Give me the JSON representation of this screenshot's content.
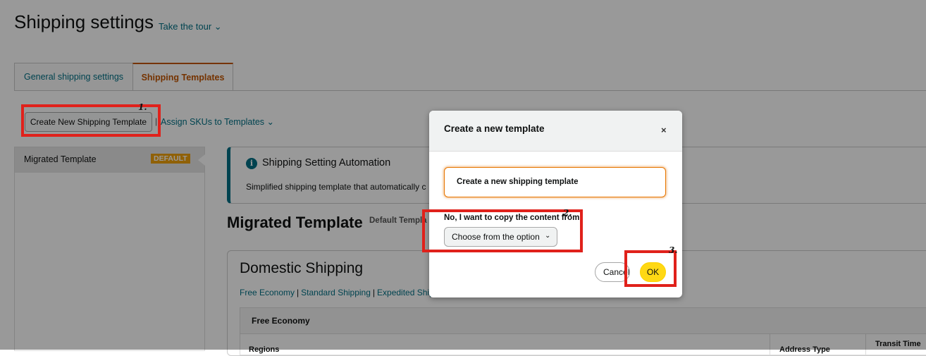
{
  "header": {
    "title": "Shipping settings",
    "tour_label": "Take the tour ⌄"
  },
  "tabs": [
    {
      "label": "General shipping settings",
      "active": false
    },
    {
      "label": "Shipping Templates",
      "active": true
    }
  ],
  "toolbar": {
    "create_label": "Create New Shipping Template",
    "separator": "|",
    "assign_label": "Assign SKUs to Templates ⌄"
  },
  "sidebar": {
    "items": [
      {
        "label": "Migrated Template",
        "badge": "DEFAULT"
      }
    ]
  },
  "automation": {
    "icon": "info-icon",
    "icon_glyph": "i",
    "title": "Shipping Setting Automation",
    "description": "Simplified shipping template that automatically c"
  },
  "template": {
    "title": "Migrated Template",
    "subtitle": "Default Templa"
  },
  "domestic": {
    "title": "Domestic Shipping",
    "links": [
      "Free Economy",
      "Standard Shipping",
      "Expedited Ship"
    ],
    "separator": "|",
    "table_header": "Free Economy",
    "columns": [
      "Regions",
      "Address Type",
      "Transit Time"
    ]
  },
  "modal": {
    "title": "Create a new template",
    "close": "×",
    "option_new": "Create a new shipping template",
    "copy_label": "No, I want to copy the content from:",
    "select_value": "Choose from the option",
    "select_chevron": "⌄",
    "cancel_label": "Cancel",
    "ok_label": "OK"
  },
  "annotations": {
    "step1": "1.",
    "step2": "2.",
    "step3": "3."
  },
  "colors": {
    "link": "#007185",
    "accent": "#c45500",
    "highlight": "#e0211b",
    "primary_button": "#ffd814"
  }
}
